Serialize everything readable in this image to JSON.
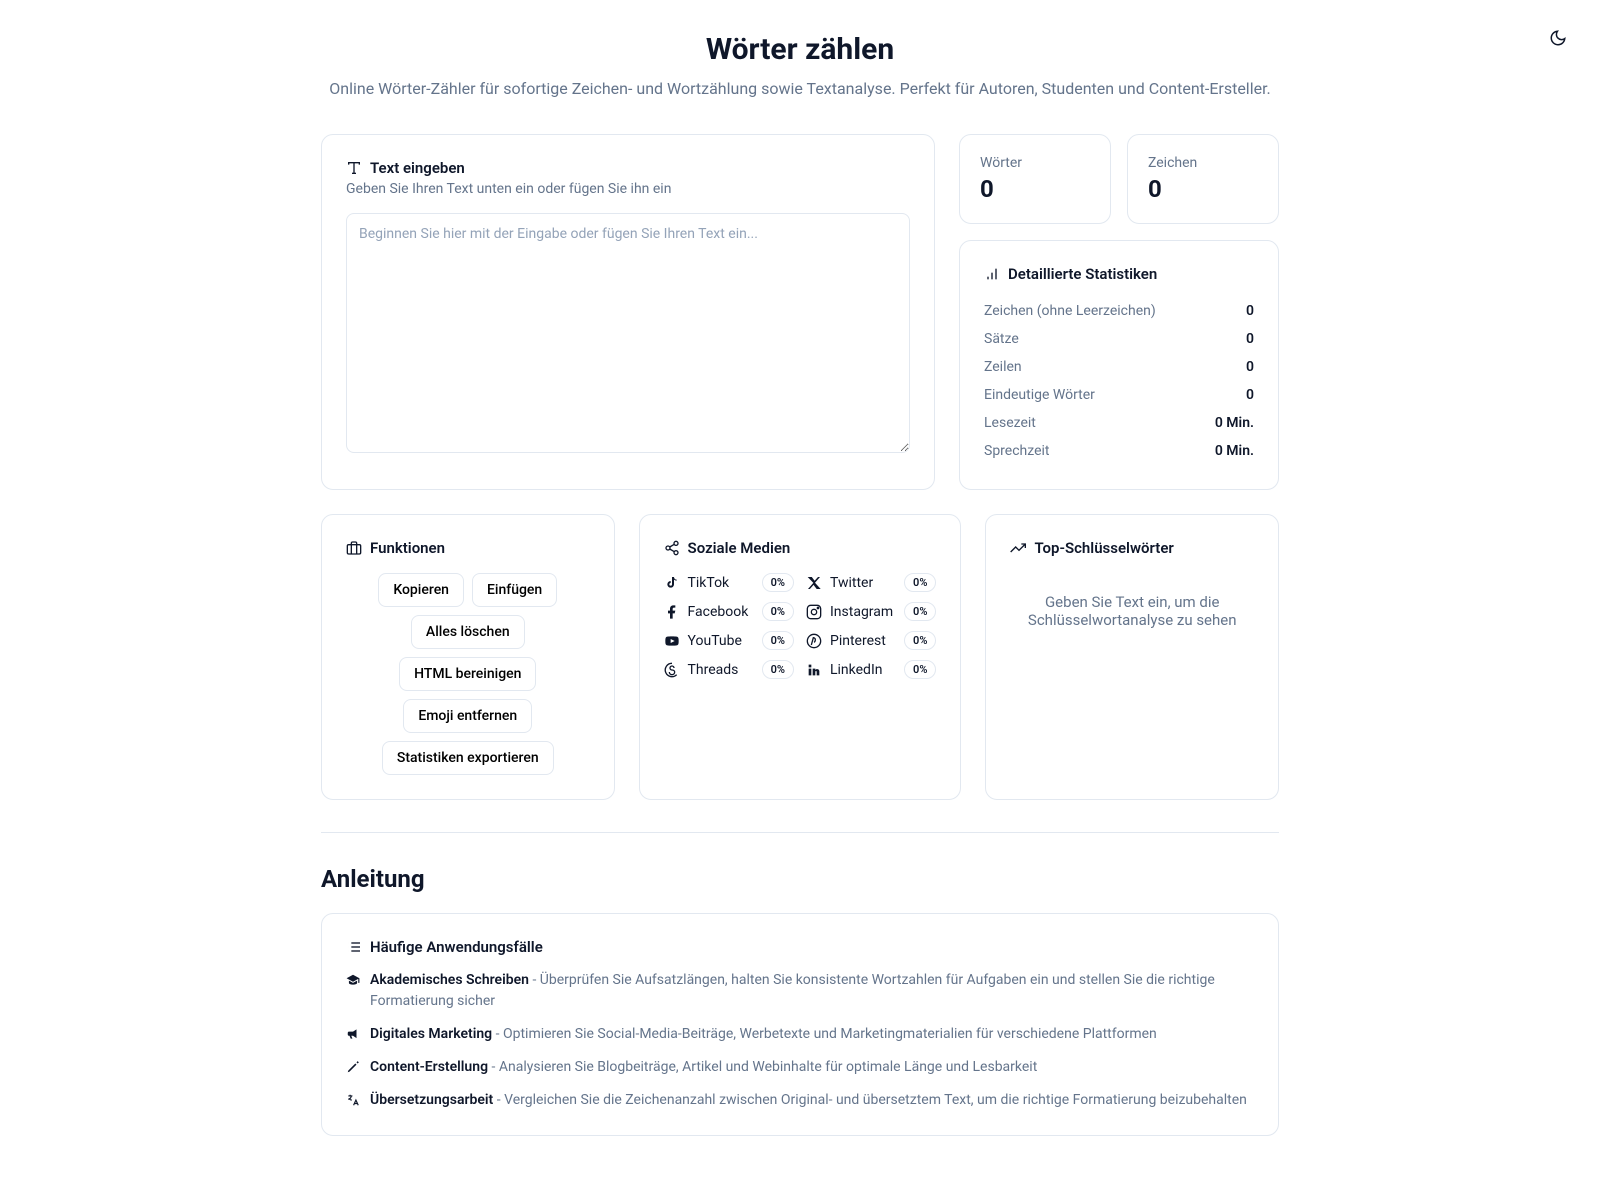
{
  "header": {
    "title": "Wörter zählen",
    "subtitle": "Online Wörter-Zähler für sofortige Zeichen- und Wortzählung sowie Textanalyse. Perfekt für Autoren, Studenten und Content-Ersteller."
  },
  "input_card": {
    "title": "Text eingeben",
    "description": "Geben Sie Ihren Text unten ein oder fügen Sie ihn ein",
    "placeholder": "Beginnen Sie hier mit der Eingabe oder fügen Sie Ihren Text ein..."
  },
  "counts": {
    "words_label": "Wörter",
    "words_value": "0",
    "chars_label": "Zeichen",
    "chars_value": "0"
  },
  "details": {
    "title": "Detaillierte Statistiken",
    "rows": {
      "chars_no_space": {
        "label": "Zeichen (ohne Leerzeichen)",
        "value": "0"
      },
      "sentences": {
        "label": "Sätze",
        "value": "0"
      },
      "lines": {
        "label": "Zeilen",
        "value": "0"
      },
      "unique_words": {
        "label": "Eindeutige Wörter",
        "value": "0"
      },
      "read_time": {
        "label": "Lesezeit",
        "value": "0 Min."
      },
      "speak_time": {
        "label": "Sprechzeit",
        "value": "0 Min."
      }
    }
  },
  "functions": {
    "title": "Funktionen",
    "buttons": {
      "copy": "Kopieren",
      "paste": "Einfügen",
      "clear": "Alles löschen",
      "clean_html": "HTML bereinigen",
      "remove_emoji": "Emoji entfernen",
      "export_stats": "Statistiken exportieren"
    }
  },
  "social": {
    "title": "Soziale Medien",
    "items": {
      "tiktok": {
        "name": "TikTok",
        "pct": "0%"
      },
      "twitter": {
        "name": "Twitter",
        "pct": "0%"
      },
      "facebook": {
        "name": "Facebook",
        "pct": "0%"
      },
      "instagram": {
        "name": "Instagram",
        "pct": "0%"
      },
      "youtube": {
        "name": "YouTube",
        "pct": "0%"
      },
      "pinterest": {
        "name": "Pinterest",
        "pct": "0%"
      },
      "threads": {
        "name": "Threads",
        "pct": "0%"
      },
      "linkedin": {
        "name": "LinkedIn",
        "pct": "0%"
      }
    }
  },
  "keywords": {
    "title": "Top-Schlüsselwörter",
    "empty": "Geben Sie Text ein, um die Schlüsselwortanalyse zu sehen"
  },
  "guide": {
    "heading": "Anleitung",
    "usecases_title": "Häufige Anwendungsfälle",
    "cases": {
      "academic": {
        "title": "Akademisches Schreiben",
        "desc": " - Überprüfen Sie Aufsatzlängen, halten Sie konsistente Wortzahlen für Aufgaben ein und stellen Sie die richtige Formatierung sicher"
      },
      "marketing": {
        "title": "Digitales Marketing",
        "desc": " - Optimieren Sie Social-Media-Beiträge, Werbetexte und Marketingmaterialien für verschiedene Plattformen"
      },
      "content": {
        "title": "Content-Erstellung",
        "desc": " - Analysieren Sie Blogbeiträge, Artikel und Webinhalte für optimale Länge und Lesbarkeit"
      },
      "translation": {
        "title": "Übersetzungsarbeit",
        "desc": " - Vergleichen Sie die Zeichenanzahl zwischen Original- und übersetztem Text, um die richtige Formatierung beizubehalten"
      }
    }
  }
}
